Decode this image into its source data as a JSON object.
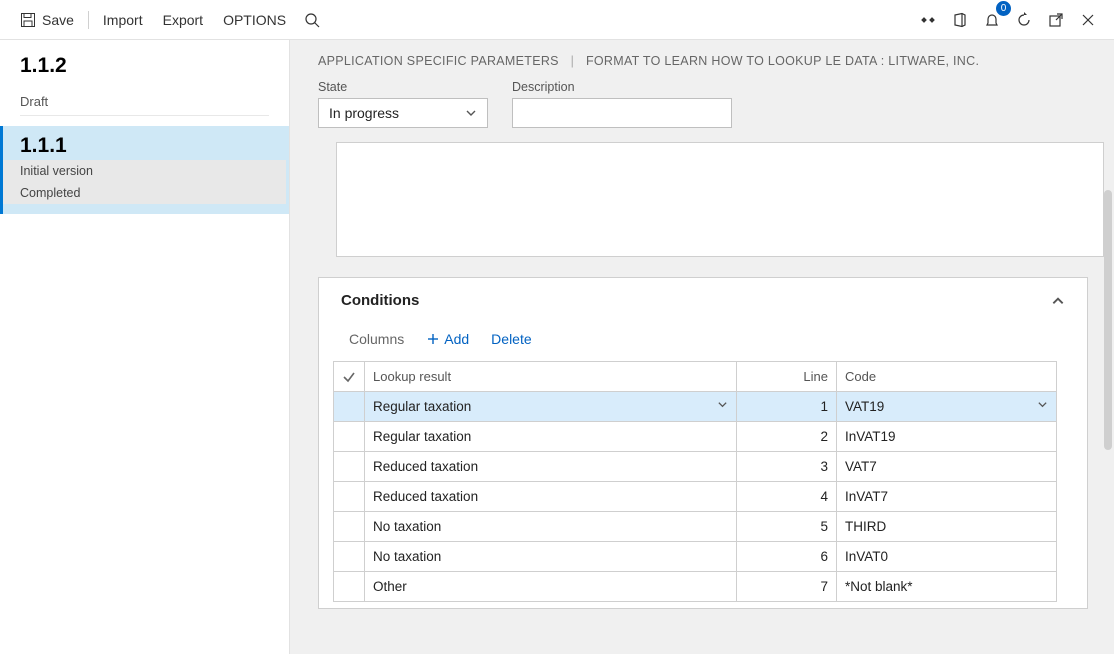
{
  "toolbar": {
    "save": "Save",
    "import": "Import",
    "export": "Export",
    "options": "OPTIONS",
    "notify_count": "0"
  },
  "sidebar": {
    "items": [
      {
        "version": "1.1.2",
        "status": "Draft",
        "selected": false
      },
      {
        "version": "1.1.1",
        "sub": [
          "Initial version",
          "Completed"
        ],
        "selected": true
      }
    ]
  },
  "breadcrumb": {
    "a": "APPLICATION SPECIFIC PARAMETERS",
    "b": "FORMAT TO LEARN HOW TO LOOKUP LE DATA : LITWARE, INC."
  },
  "fields": {
    "state_label": "State",
    "state_value": "In progress",
    "desc_label": "Description",
    "desc_value": ""
  },
  "conditions": {
    "title": "Conditions",
    "toolbar": {
      "columns": "Columns",
      "add": "Add",
      "delete": "Delete"
    },
    "headers": {
      "lookup": "Lookup result",
      "line": "Line",
      "code": "Code"
    },
    "rows": [
      {
        "lookup": "Regular taxation",
        "line": "1",
        "code": "VAT19",
        "sel": true
      },
      {
        "lookup": "Regular taxation",
        "line": "2",
        "code": "InVAT19"
      },
      {
        "lookup": "Reduced taxation",
        "line": "3",
        "code": "VAT7"
      },
      {
        "lookup": "Reduced taxation",
        "line": "4",
        "code": "InVAT7"
      },
      {
        "lookup": "No taxation",
        "line": "5",
        "code": "THIRD"
      },
      {
        "lookup": "No taxation",
        "line": "6",
        "code": "InVAT0"
      },
      {
        "lookup": "Other",
        "line": "7",
        "code": "*Not blank*"
      }
    ]
  }
}
